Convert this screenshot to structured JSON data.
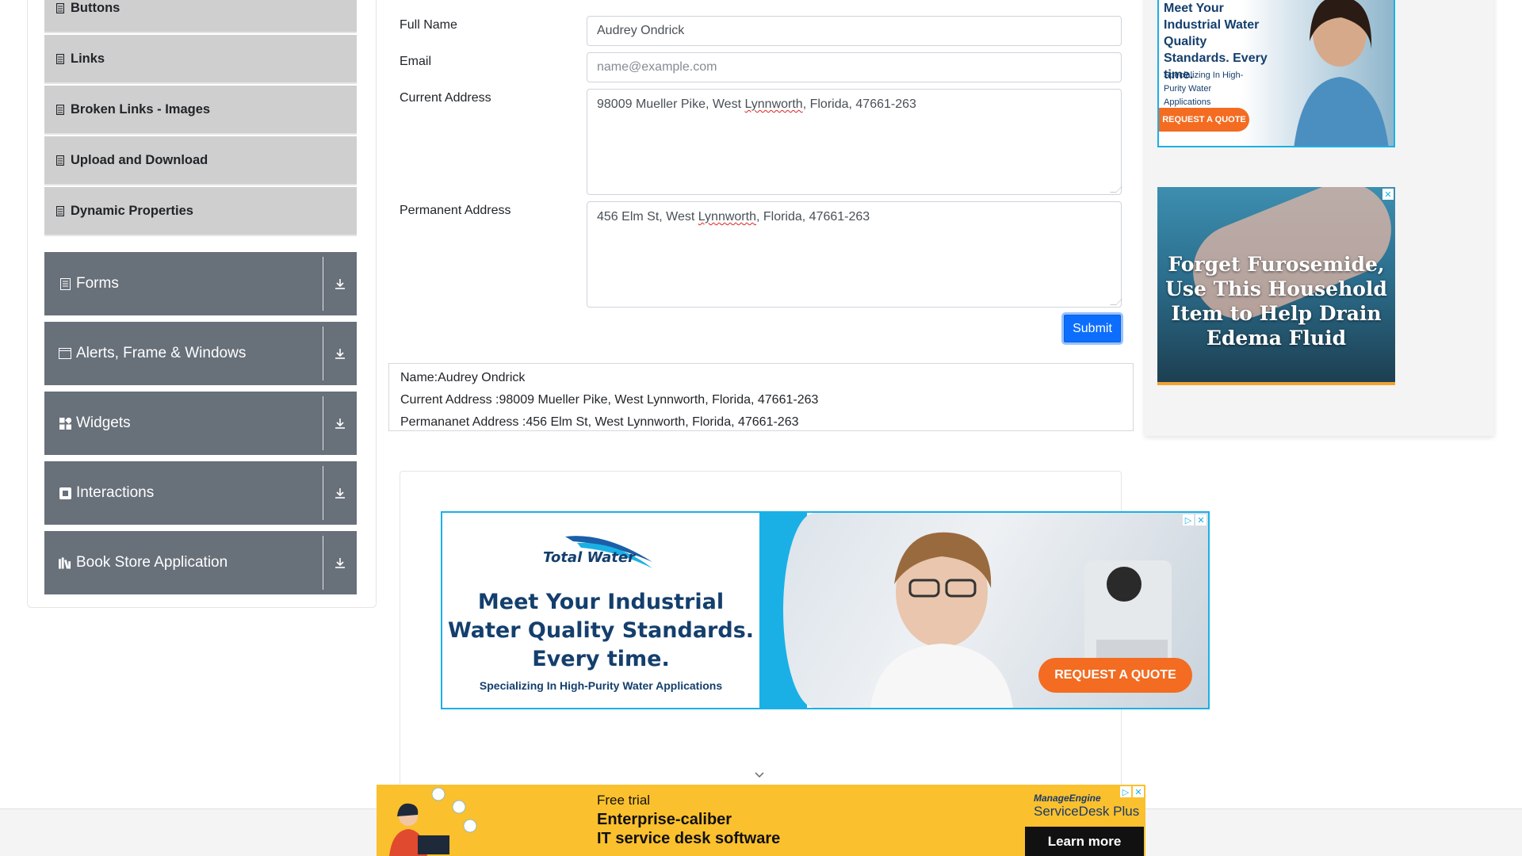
{
  "sidebar": {
    "sub_items": [
      {
        "label": "Buttons"
      },
      {
        "label": "Links"
      },
      {
        "label": "Broken Links - Images"
      },
      {
        "label": "Upload and Download"
      },
      {
        "label": "Dynamic Properties"
      }
    ],
    "groups": [
      {
        "label": "Forms",
        "icon": "form-icon"
      },
      {
        "label": "Alerts, Frame & Windows",
        "icon": "window-icon"
      },
      {
        "label": "Widgets",
        "icon": "widgets-icon"
      },
      {
        "label": "Interactions",
        "icon": "interactions-icon"
      },
      {
        "label": "Book Store Application",
        "icon": "books-icon"
      }
    ]
  },
  "form": {
    "full_name_label": "Full Name",
    "full_name_value": "Audrey Ondrick",
    "email_label": "Email",
    "email_placeholder": "name@example.com",
    "current_address_label": "Current Address",
    "current_address_pre": "98009 Mueller Pike, West ",
    "current_address_mark": "Lynnworth",
    "current_address_post": ", Florida, 47661-263",
    "permanent_address_label": "Permanent Address",
    "permanent_address_pre": "456 Elm St, West ",
    "permanent_address_mark": "Lynnworth",
    "permanent_address_post": ", Florida, 47661-263",
    "submit_label": "Submit"
  },
  "output": {
    "name": "Name:Audrey Ondrick",
    "current_address": "Current Address :98009 Mueller Pike, West Lynnworth, Florida, 47661-263",
    "permanent_address": "Permananet Address :456 Elm St, West Lynnworth, Florida, 47661-263"
  },
  "ads": {
    "center": {
      "brand": "Total Water",
      "headline": "Meet Your Industrial Water Quality Standards. Every time.",
      "subline": "Specializing In High-Purity Water Applications",
      "cta": "REQUEST A QUOTE"
    },
    "right_top": {
      "headline": "Meet Your Industrial Water Quality Standards. Every time.",
      "subline": "Specializing In High-Purity Water Applications",
      "cta": "REQUEST A QUOTE"
    },
    "right_bottom": {
      "headline": "Forget Furosemide, Use This Household Item to Help Drain Edema Fluid"
    },
    "bottom": {
      "line1": "Free trial",
      "line2": "Enterprise-caliber",
      "line3": "IT service desk software",
      "brand_top": "ManageEngine",
      "brand_main": "ServiceDesk Plus",
      "cta": "Learn more"
    }
  },
  "colors": {
    "primary": "#0d6efd",
    "group_bg": "#68707a",
    "sub_item_bg": "#cfcfcf",
    "ad_orange": "#f36c21",
    "ad_blue": "#1ab0e6"
  }
}
